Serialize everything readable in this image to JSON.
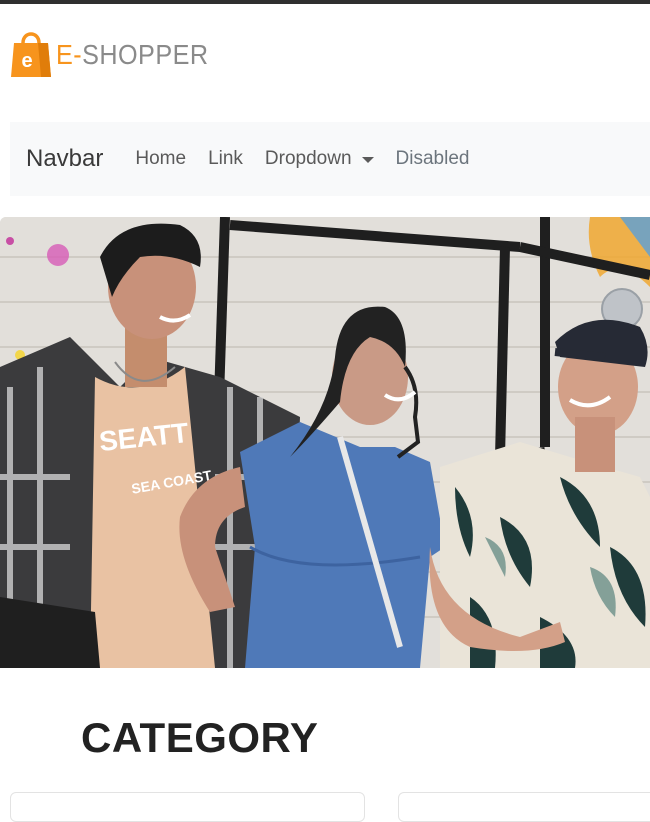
{
  "logo": {
    "bag_letter": "e",
    "text_prefix": "E-",
    "text_main": "SHOPPER",
    "icon": "shopping-bag-icon",
    "accent_color": "#f7941d",
    "text_color": "#8a8a8a"
  },
  "navbar": {
    "brand": "Navbar",
    "items": [
      {
        "label": "Home"
      },
      {
        "label": "Link"
      },
      {
        "label": "Dropdown",
        "icon": "caret-down-icon"
      },
      {
        "label": "Disabled"
      }
    ],
    "background": "#f8f9fa"
  },
  "hero": {
    "description_alt": "Fashion banner photo",
    "shirt_print": [
      "SEATT",
      "SEA COAST"
    ]
  },
  "category": {
    "title": "CATEGORY"
  }
}
